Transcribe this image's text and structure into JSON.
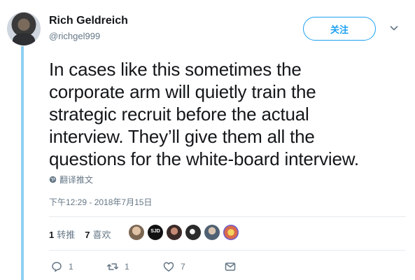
{
  "user": {
    "name": "Rich Geldreich",
    "handle": "@richgel999"
  },
  "follow_button": {
    "label": "关注"
  },
  "tweet": {
    "text_lines": [
      "In cases like this sometimes the",
      "corporate arm will quietly train the",
      "strategic recruit before the actual",
      "interview. They’ll give them all the",
      "questions for the white-board interview."
    ],
    "translate_label": "翻译推文",
    "timestamp": "下午12:29 - 2018年7月15日"
  },
  "stats": {
    "retweets_count": "1",
    "retweets_label": "转推",
    "likes_count": "7",
    "likes_label": "喜欢"
  },
  "likers": [
    {
      "icon": "avatar-photo",
      "color": "#c9a789"
    },
    {
      "icon": "sjd-logo-avatar",
      "color": "#111111",
      "text": "SJD"
    },
    {
      "icon": "avatar-photo",
      "color": "#4a3a36"
    },
    {
      "icon": "avatar-cartoon",
      "color": "#2b2b2b"
    },
    {
      "icon": "avatar-photo",
      "color": "#6c7f93"
    },
    {
      "icon": "avatar-illustration",
      "color": "#e8a050"
    }
  ],
  "actions": {
    "reply_count": "1",
    "retweet_count": "1",
    "like_count": "7"
  },
  "colors": {
    "accent": "#1da1f2",
    "thread_line": "#8fd0f1",
    "muted_text": "#657786"
  }
}
